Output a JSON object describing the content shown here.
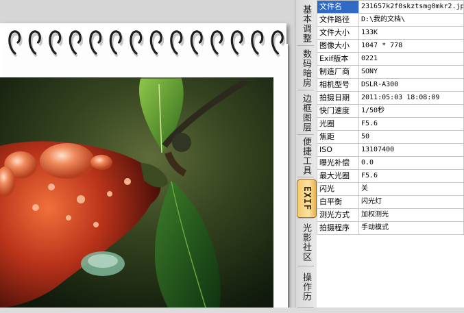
{
  "tabs": [
    {
      "label": "基本调整",
      "active": false
    },
    {
      "label": "数码暗房",
      "active": false
    },
    {
      "label": "边框图层",
      "active": false
    },
    {
      "label": "便捷工具",
      "active": false
    },
    {
      "label": "EXIF",
      "active": true
    },
    {
      "label": "光影社区",
      "active": false
    },
    {
      "label": "操作历",
      "active": false
    }
  ],
  "exif": {
    "rows": [
      {
        "key": "文件名",
        "value": "231657k2f0skztsmg0mkr2.jp"
      },
      {
        "key": "文件路径",
        "value": "D:\\我的文档\\"
      },
      {
        "key": "文件大小",
        "value": "133K"
      },
      {
        "key": "图像大小",
        "value": "1047 * 778"
      },
      {
        "key": "Exif版本",
        "value": "0221"
      },
      {
        "key": "制造厂商",
        "value": "SONY"
      },
      {
        "key": "相机型号",
        "value": "DSLR-A300"
      },
      {
        "key": "拍摄日期",
        "value": "2011:05:03 18:08:09"
      },
      {
        "key": "快门速度",
        "value": "1/50秒"
      },
      {
        "key": "光圈",
        "value": "F5.6"
      },
      {
        "key": "焦距",
        "value": "50"
      },
      {
        "key": "ISO",
        "value": "13107400"
      },
      {
        "key": "曝光补偿",
        "value": "0.0"
      },
      {
        "key": "最大光圈",
        "value": "F5.6"
      },
      {
        "key": "闪光",
        "value": "关"
      },
      {
        "key": "白平衡",
        "value": "闪光灯"
      },
      {
        "key": "测光方式",
        "value": "加权测光"
      },
      {
        "key": "拍摄程序",
        "value": "手动模式"
      }
    ],
    "selected_row": 0
  },
  "colors": {
    "selection": "#316ac5",
    "active_tab": "#f4c96a",
    "grid_line": "#c8c8c8"
  },
  "icons": [
    "spiral-binding-ring"
  ]
}
